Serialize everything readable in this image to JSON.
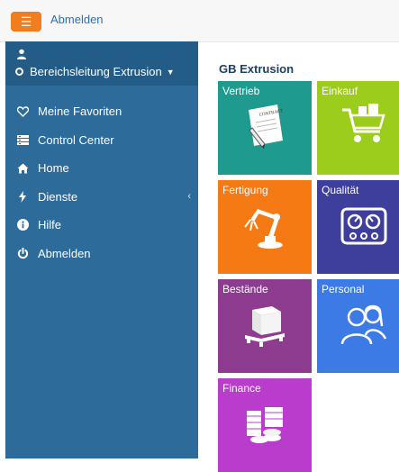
{
  "topbar": {
    "menu_icon": "hamburger-icon",
    "logout_label": "Abmelden"
  },
  "sidebar": {
    "user": {
      "name": "Bereichsleitung Extrusion"
    },
    "items": [
      {
        "label": "Meine Favoriten",
        "icon": "heart-icon"
      },
      {
        "label": "Control Center",
        "icon": "list-icon"
      },
      {
        "label": "Home",
        "icon": "home-icon"
      },
      {
        "label": "Dienste",
        "icon": "bolt-icon",
        "has_submenu": true
      },
      {
        "label": "Hilfe",
        "icon": "info-icon"
      },
      {
        "label": "Abmelden",
        "icon": "power-icon"
      }
    ]
  },
  "main": {
    "title": "GB Extrusion",
    "tiles": [
      {
        "label": "Vertrieb",
        "color": "#1f9a8f",
        "icon": "contract-icon"
      },
      {
        "label": "Einkauf",
        "color": "#9ccc1c",
        "icon": "cart-icon"
      },
      {
        "label": "Fertigung",
        "color": "#f57a14",
        "icon": "robot-arm-icon"
      },
      {
        "label": "Qualität",
        "color": "#3e3e9c",
        "icon": "gauge-icon"
      },
      {
        "label": "Bestände",
        "color": "#8d3c8f",
        "icon": "pallet-icon"
      },
      {
        "label": "Personal",
        "color": "#3c7be6",
        "icon": "people-icon"
      },
      {
        "label": "Finance",
        "color": "#b93ccc",
        "icon": "coins-icon"
      }
    ]
  }
}
